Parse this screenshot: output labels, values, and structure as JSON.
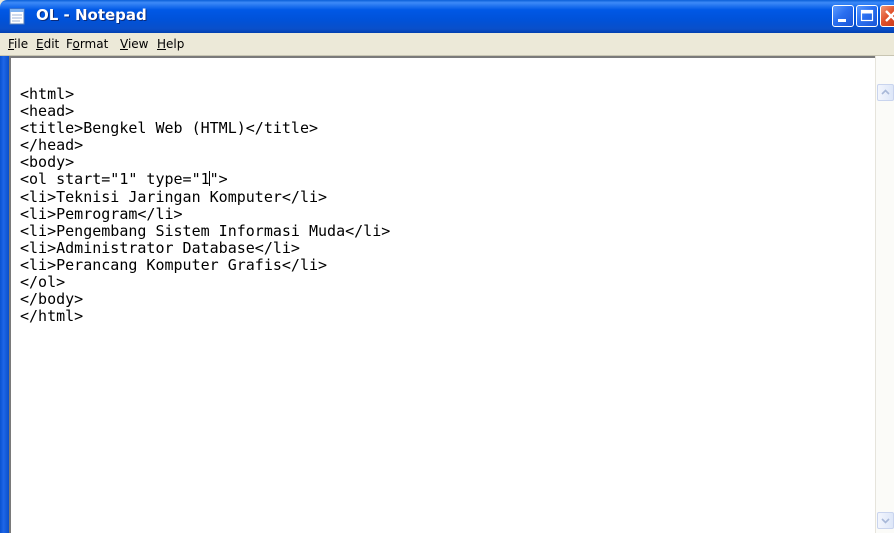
{
  "window": {
    "title": "OL - Notepad",
    "controls": [
      "minimize-icon",
      "maximize-icon",
      "close-icon"
    ],
    "colors": {
      "titlebar": "#0058e6",
      "close_button": "#e0502a",
      "chrome": "#ece9d8"
    }
  },
  "menu": {
    "file": {
      "accel": "F",
      "rest": "ile"
    },
    "edit": {
      "accel": "E",
      "rest": "dit"
    },
    "format": {
      "pre": "F",
      "accel": "o",
      "rest": "rmat"
    },
    "view": {
      "accel": "V",
      "rest": "iew"
    },
    "help": {
      "accel": "H",
      "rest": "elp"
    }
  },
  "editor": {
    "lines": [
      "<html>",
      "<head>",
      "<title>Bengkel Web (HTML)</title>",
      "</head>",
      "<body>",
      "<ol start=\"1\" type=\"1\">",
      "<li>Teknisi Jaringan Komputer</li>",
      "<li>Pemrogram</li>",
      "<li>Pengembang Sistem Informasi Muda</li>",
      "<li>Administrator Database</li>",
      "<li>Perancang Komputer Grafis</li>",
      "</ol>",
      "</body>",
      "</html>"
    ],
    "caret_line_before": "<ol start=\"1\" type=\"1",
    "caret_line_after": "\">"
  },
  "scrollbar": {
    "up_icon": "scroll-up-arrow-icon",
    "down_icon": "scroll-down-arrow-icon"
  }
}
